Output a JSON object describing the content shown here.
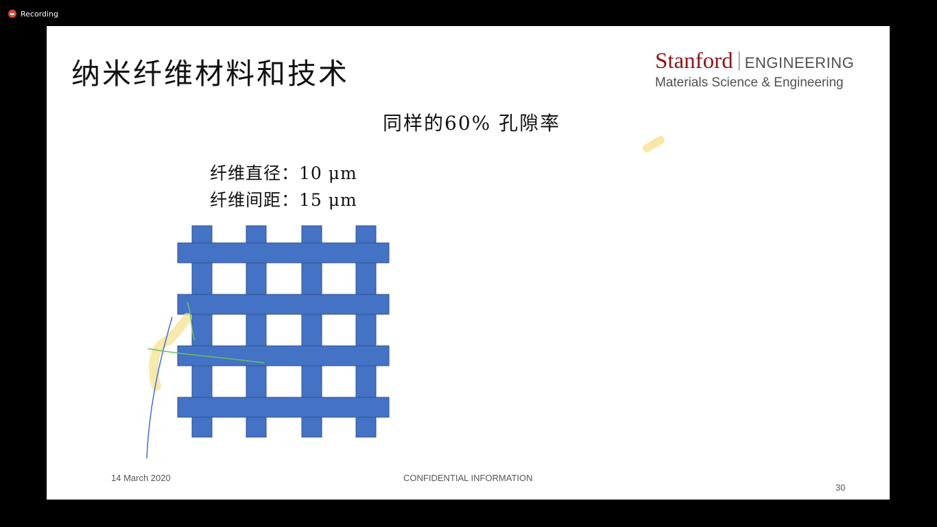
{
  "recording": {
    "label": "Recording",
    "color": "#e0452e"
  },
  "slide": {
    "title": "纳米纤维材料和技术",
    "logo": {
      "stanford": "Stanford",
      "engineering": "ENGINEERING",
      "department": "Materials Science & Engineering"
    },
    "subtitle": "同样的60% 孔隙率",
    "specs": {
      "diameter": "纤维直径：10 μm",
      "spacing": "纤维间距：15 μm"
    },
    "grid": {
      "fill": "#4472c4",
      "stroke": "#2f528f",
      "vertical_fibers": 4,
      "horizontal_fibers": 4
    },
    "footer": {
      "date": "14 March 2020",
      "confidential": "CONFIDENTIAL INFORMATION",
      "page": "30"
    }
  }
}
